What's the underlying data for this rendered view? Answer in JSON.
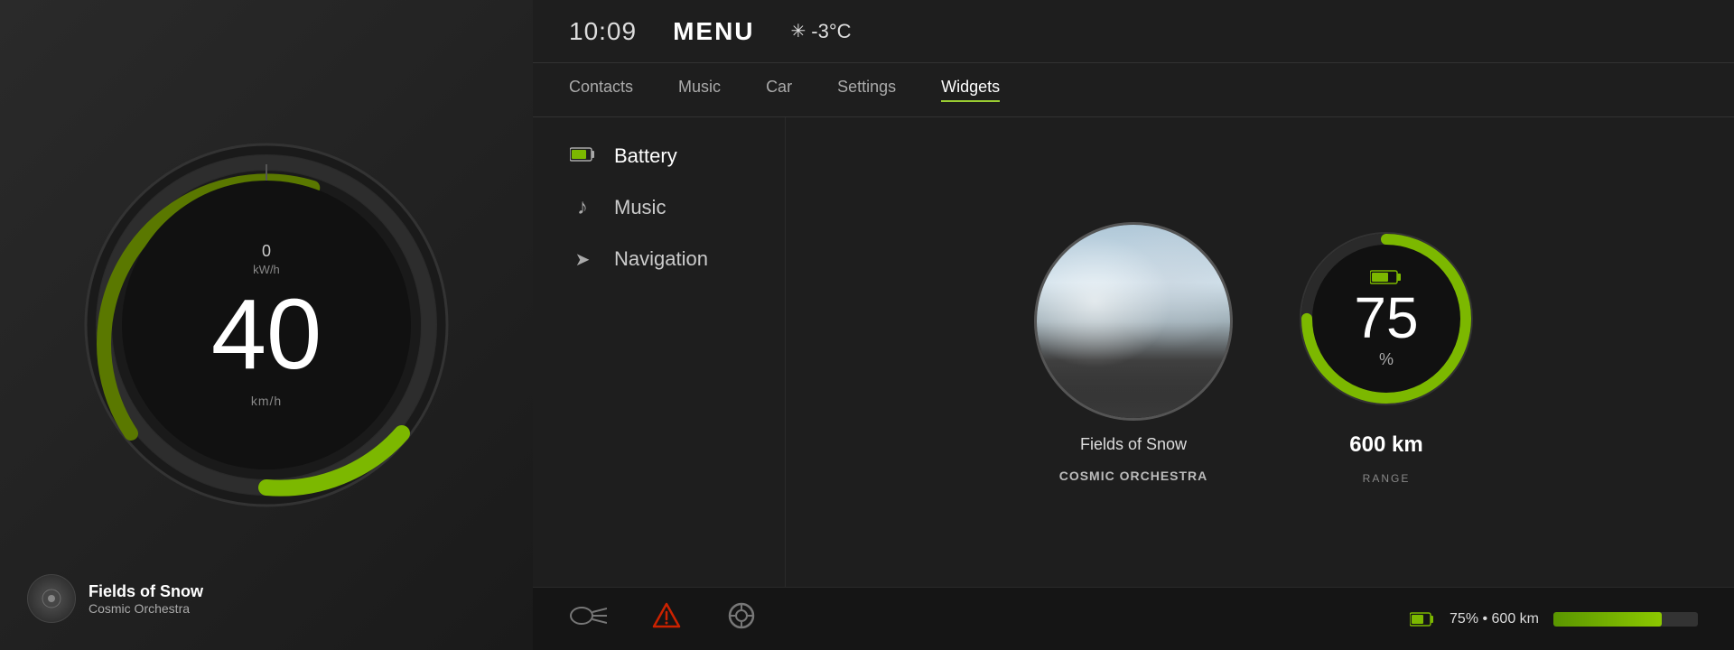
{
  "header": {
    "time": "10:09",
    "menu_label": "MENU",
    "temperature": "-3°C",
    "snowflake_symbol": "✳"
  },
  "nav": {
    "tabs": [
      {
        "id": "contacts",
        "label": "Contacts",
        "active": false
      },
      {
        "id": "music",
        "label": "Music",
        "active": false
      },
      {
        "id": "car",
        "label": "Car",
        "active": false
      },
      {
        "id": "settings",
        "label": "Settings",
        "active": false
      },
      {
        "id": "widgets",
        "label": "Widgets",
        "active": true
      }
    ]
  },
  "menu": {
    "items": [
      {
        "id": "battery",
        "label": "Battery",
        "icon": "🔋",
        "active": true
      },
      {
        "id": "music",
        "label": "Music",
        "icon": "♪",
        "active": false
      },
      {
        "id": "navigation",
        "label": "Navigation",
        "icon": "➤",
        "active": false
      }
    ]
  },
  "speedometer": {
    "speed": "40",
    "speed_unit": "km/h",
    "power": "0",
    "power_unit": "kW/h"
  },
  "now_playing": {
    "track": "Fields of Snow",
    "artist": "Cosmic Orchestra"
  },
  "music_widget": {
    "track": "Fields of Snow",
    "artist": "COSMIC ORCHESTRA"
  },
  "battery_widget": {
    "percent": "75",
    "percent_sign": "%",
    "range_value": "600 km",
    "range_label": "RANGE",
    "battery_icon": "🔋"
  },
  "bottom_bar": {
    "status_text": "75% • 600 km",
    "bar_fill_percent": 75,
    "icons": [
      {
        "id": "headlights",
        "symbol": "⊶",
        "warning": false
      },
      {
        "id": "alert",
        "symbol": "⚠",
        "warning": true
      },
      {
        "id": "tire",
        "symbol": "⊙",
        "warning": false
      }
    ]
  }
}
